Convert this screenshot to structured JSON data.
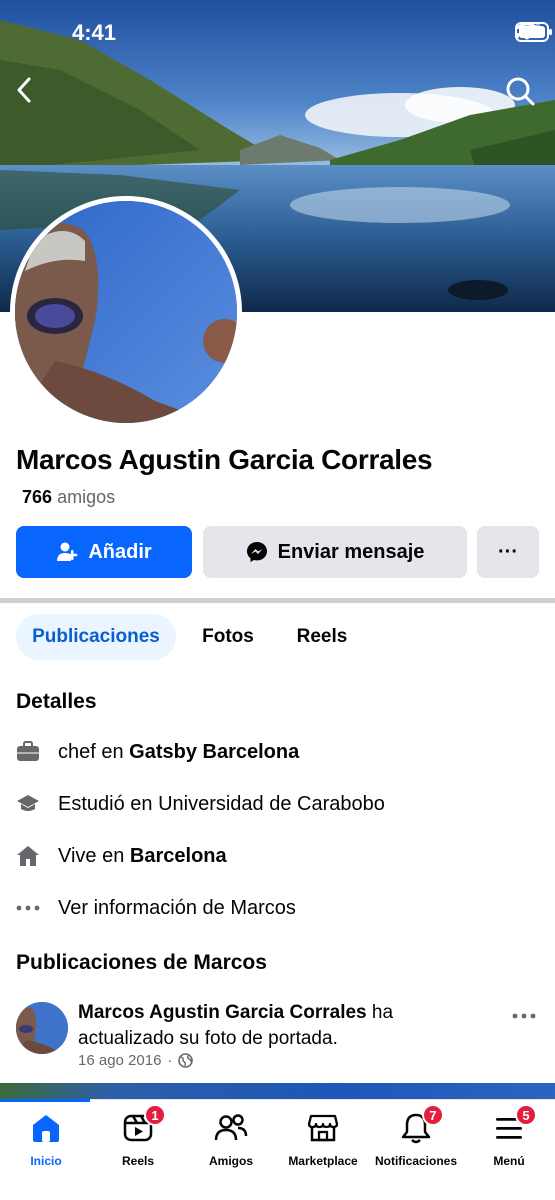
{
  "status": {
    "time": "4:41"
  },
  "profile": {
    "name": "Marcos Agustin Garcia Corrales",
    "friends_count": "766",
    "friends_label": "amigos"
  },
  "actions": {
    "add_label": "Añadir",
    "message_label": "Enviar mensaje",
    "more_label": "···"
  },
  "tabs": [
    {
      "label": "Publicaciones",
      "active": true
    },
    {
      "label": "Fotos",
      "active": false
    },
    {
      "label": "Reels",
      "active": false
    }
  ],
  "details": {
    "title": "Detalles",
    "work": {
      "prefix": "chef en",
      "place": "Gatsby Barcelona",
      "icon": "briefcase-icon"
    },
    "education": {
      "text": "Estudió en Universidad de Carabobo",
      "icon": "graduation-cap-icon"
    },
    "home": {
      "prefix": "Vive en",
      "place": "Barcelona",
      "icon": "home-icon"
    },
    "more": {
      "text": "Ver información de Marcos",
      "icon": "more-dots-icon"
    }
  },
  "posts": {
    "title": "Publicaciones de Marcos",
    "first": {
      "author": "Marcos Agustin Garcia Corrales",
      "action": "ha actualizado su foto de portada.",
      "date": "16 ago 2016",
      "separator": "·"
    }
  },
  "bottom_nav": [
    {
      "label": "Inicio",
      "icon": "home-icon",
      "badge": "",
      "active": true
    },
    {
      "label": "Reels",
      "icon": "reels-icon",
      "badge": "1",
      "active": false
    },
    {
      "label": "Amigos",
      "icon": "friends-icon",
      "badge": "",
      "active": false
    },
    {
      "label": "Marketplace",
      "icon": "marketplace-icon",
      "badge": "",
      "active": false
    },
    {
      "label": "Notificaciones",
      "icon": "bell-icon",
      "badge": "7",
      "active": false
    },
    {
      "label": "Menú",
      "icon": "menu-icon",
      "badge": "5",
      "active": false
    }
  ],
  "colors": {
    "accent": "#0866ff",
    "badge": "#e41e3f",
    "active_tab_bg": "#ebf5ff",
    "secondary_button": "#e4e6eb"
  }
}
